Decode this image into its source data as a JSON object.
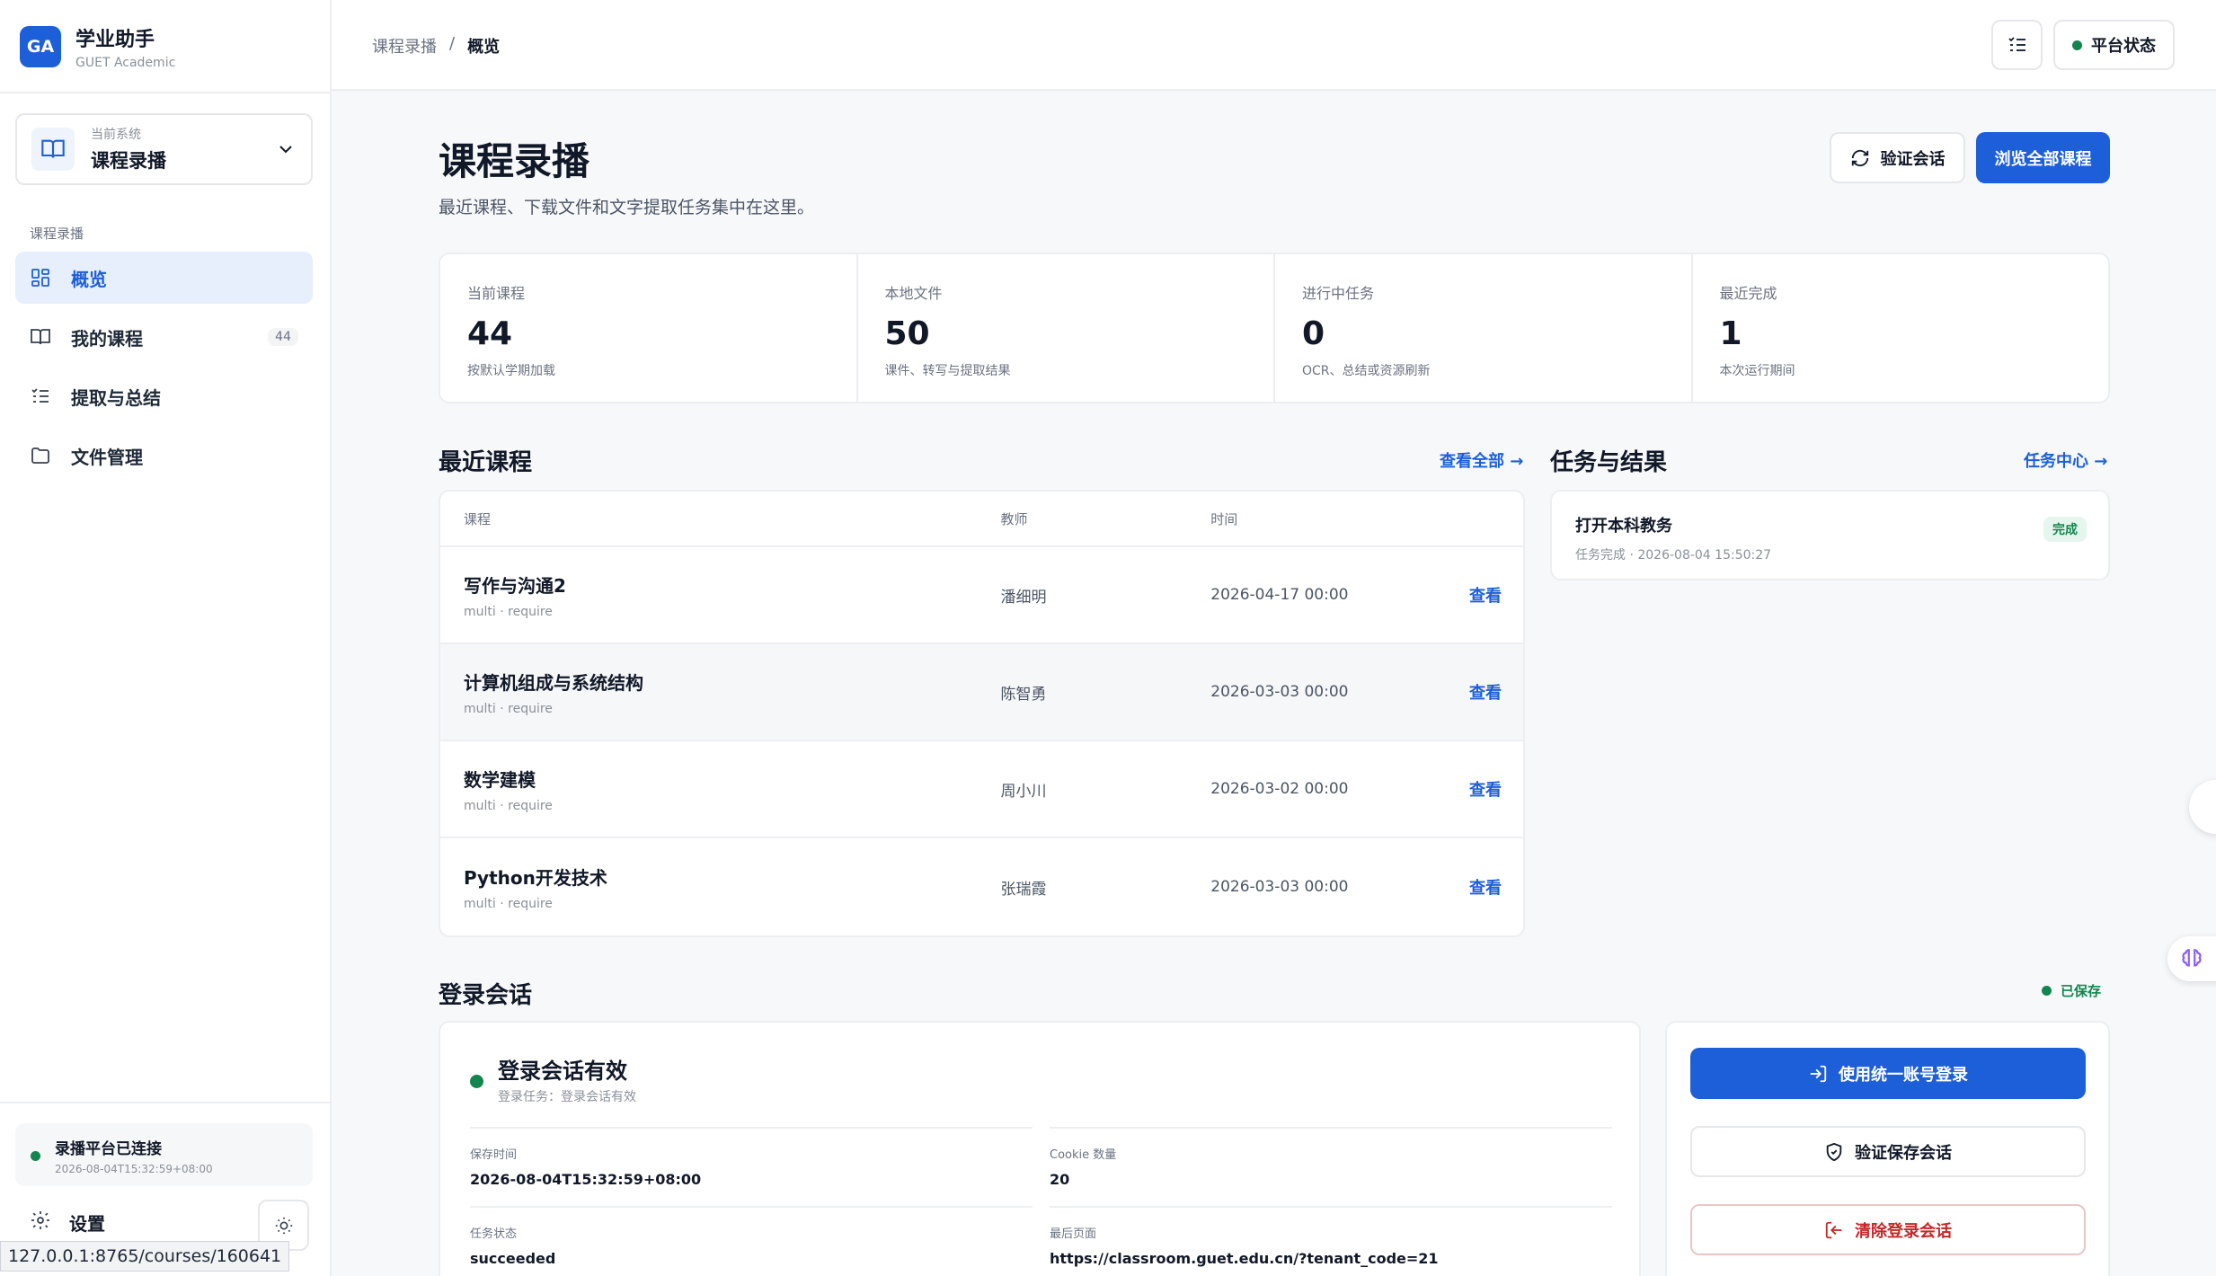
{
  "brand": {
    "logo": "GA",
    "title": "学业助手",
    "subtitle": "GUET Academic"
  },
  "system": {
    "label": "当前系统",
    "value": "课程录播"
  },
  "nav": {
    "section_title": "课程录播",
    "items": [
      {
        "label": "概览",
        "icon": "grid-icon",
        "active": true
      },
      {
        "label": "我的课程",
        "icon": "book-icon",
        "badge": "44"
      },
      {
        "label": "提取与总结",
        "icon": "list-icon"
      },
      {
        "label": "文件管理",
        "icon": "folder-icon"
      }
    ]
  },
  "connection": {
    "title": "录播平台已连接",
    "time": "2026-08-04T15:32:59+08:00"
  },
  "settings_label": "设置",
  "url_tooltip": "127.0.0.1:8765/courses/160641",
  "breadcrumb": {
    "parent": "课程录播",
    "sep": "/",
    "current": "概览"
  },
  "platform_status": "平台状态",
  "header": {
    "title": "课程录播",
    "subtitle": "最近课程、下载文件和文字提取任务集中在这里。",
    "verify_btn": "验证会话",
    "browse_btn": "浏览全部课程"
  },
  "stats": [
    {
      "label": "当前课程",
      "value": "44",
      "note": "按默认学期加载"
    },
    {
      "label": "本地文件",
      "value": "50",
      "note": "课件、转写与提取结果"
    },
    {
      "label": "进行中任务",
      "value": "0",
      "note": "OCR、总结或资源刷新"
    },
    {
      "label": "最近完成",
      "value": "1",
      "note": "本次运行期间"
    }
  ],
  "recent": {
    "title": "最近课程",
    "view_all": "查看全部 →",
    "columns": [
      "课程",
      "教师",
      "时间"
    ],
    "rows": [
      {
        "name": "写作与沟通2",
        "meta": "multi · require",
        "teacher": "潘细明",
        "time": "2026-04-17 00:00",
        "action": "查看"
      },
      {
        "name": "计算机组成与系统结构",
        "meta": "multi · require",
        "teacher": "陈智勇",
        "time": "2026-03-03 00:00",
        "action": "查看"
      },
      {
        "name": "数学建模",
        "meta": "multi · require",
        "teacher": "周小川",
        "time": "2026-03-02 00:00",
        "action": "查看"
      },
      {
        "name": "Python开发技术",
        "meta": "multi · require",
        "teacher": "张瑞霞",
        "time": "2026-03-03 00:00",
        "action": "查看"
      }
    ]
  },
  "tasks": {
    "title": "任务与结果",
    "center_link": "任务中心 →",
    "items": [
      {
        "title": "打开本科教务",
        "meta": "任务完成 · 2026-08-04 15:50:27",
        "status": "完成"
      }
    ]
  },
  "session": {
    "title": "登录会话",
    "saved": "已保存",
    "status_title": "登录会话有效",
    "status_sub": "登录任务：登录会话有效",
    "fields": [
      {
        "key": "保存时间",
        "value": "2026-08-04T15:32:59+08:00"
      },
      {
        "key": "Cookie 数量",
        "value": "20"
      },
      {
        "key": "任务状态",
        "value": "succeeded"
      },
      {
        "key": "最后页面",
        "value": "https://classroom.guet.edu.cn/?tenant_code=21"
      }
    ],
    "login_btn": "使用统一账号登录",
    "verify_btn": "验证保存会话",
    "clear_btn": "清除登录会话"
  },
  "colors": {
    "accent": "#1d5fd8",
    "success": "#13854f",
    "danger": "#c62828"
  }
}
